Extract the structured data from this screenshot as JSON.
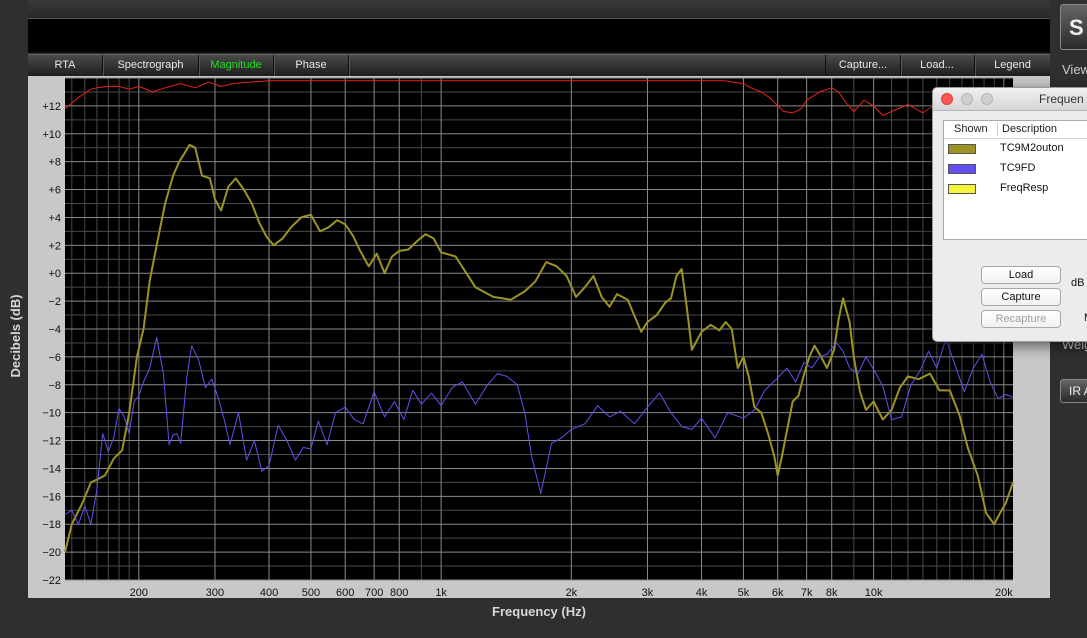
{
  "tabs": {
    "left": [
      {
        "label": "RTA",
        "active": false
      },
      {
        "label": "Spectrograph",
        "active": false
      },
      {
        "label": "Magnitude",
        "active": true
      },
      {
        "label": "Phase",
        "active": false
      }
    ],
    "right": [
      {
        "label": "Capture..."
      },
      {
        "label": "Load..."
      },
      {
        "label": "Legend"
      }
    ]
  },
  "side_panel": {
    "button_initial": "S",
    "view_label": "View",
    "weight_label": "Weig",
    "ir_button": "IR A"
  },
  "legend_window": {
    "title": "Frequen",
    "col_shown": "Shown",
    "col_description": "Description",
    "rows": [
      {
        "name": "TC9M2outon",
        "color": "#9b9422"
      },
      {
        "name": "TC9FD",
        "color": "#6250ee"
      },
      {
        "name": "FreqResp",
        "color": "#f4f43a"
      }
    ],
    "buttons": {
      "load": "Load",
      "capture": "Capture",
      "recapture": "Recapture"
    },
    "side_text": {
      "db": "dB",
      "m": "M"
    }
  },
  "chart_data": {
    "type": "line",
    "title": "",
    "xlabel": "Frequency (Hz)",
    "ylabel": "Decibels (dB)",
    "xscale": "log",
    "xlim": [
      135,
      21000
    ],
    "ylim": [
      -22,
      14
    ],
    "grid": true,
    "x_ticks": [
      200,
      300,
      400,
      500,
      600,
      700,
      800,
      1000,
      2000,
      3000,
      4000,
      5000,
      6000,
      7000,
      8000,
      10000,
      20000
    ],
    "x_tick_labels": [
      "200",
      "300",
      "400",
      "500",
      "600",
      "700",
      "800",
      "1k",
      "2k",
      "3k",
      "4k",
      "5k",
      "6k",
      "7k",
      "8k",
      "10k",
      "20k"
    ],
    "y_ticks": [
      -22,
      -20,
      -18,
      -16,
      -14,
      -12,
      -10,
      -8,
      -6,
      -4,
      -2,
      0,
      2,
      4,
      6,
      8,
      10,
      12
    ],
    "y_tick_labels": [
      "−22",
      "−20",
      "−18",
      "−16",
      "−14",
      "−12",
      "−10",
      "−8",
      "−6",
      "−4",
      "−2",
      "+0",
      "+2",
      "+4",
      "+6",
      "+8",
      "+10",
      "+12"
    ],
    "series": [
      {
        "name": "TC9M2outon",
        "color": "#9b9422",
        "x": [
          135,
          140,
          148,
          155,
          160,
          167,
          175,
          183,
          190,
          198,
          205,
          212,
          220,
          230,
          240,
          248,
          255,
          262,
          270,
          280,
          292,
          300,
          310,
          322,
          335,
          350,
          365,
          380,
          395,
          410,
          430,
          450,
          475,
          500,
          525,
          550,
          575,
          600,
          625,
          650,
          680,
          710,
          740,
          770,
          800,
          840,
          880,
          920,
          960,
          1000,
          1080,
          1200,
          1320,
          1450,
          1560,
          1650,
          1750,
          1850,
          1950,
          2050,
          2150,
          2250,
          2350,
          2450,
          2550,
          2700,
          2900,
          3000,
          3150,
          3300,
          3400,
          3500,
          3600,
          3700,
          3800,
          4000,
          4200,
          4400,
          4550,
          4700,
          4850,
          5000,
          5150,
          5300,
          5500,
          5700,
          5900,
          6000,
          6150,
          6300,
          6500,
          6700,
          6900,
          7100,
          7300,
          7500,
          7800,
          8100,
          8300,
          8500,
          8800,
          9000,
          9300,
          9600,
          10000,
          10500,
          11000,
          11500,
          12000,
          12700,
          13500,
          14200,
          15000,
          15800,
          16500,
          17400,
          18200,
          19000,
          19600,
          20200,
          21000
        ],
        "y": [
          -20,
          -18,
          -16.5,
          -15,
          -14.8,
          -14.5,
          -13.3,
          -12.7,
          -10,
          -6,
          -4,
          -0.5,
          2,
          5,
          7,
          8,
          8.6,
          9.2,
          9,
          7,
          6.8,
          5.3,
          4.5,
          6.2,
          6.8,
          6,
          5,
          3.6,
          2.6,
          2,
          2.5,
          3.3,
          4,
          4.2,
          3,
          3.3,
          3.8,
          3.5,
          2.7,
          1.6,
          0.5,
          1.4,
          0,
          1.2,
          1.6,
          1.7,
          2.3,
          2.8,
          2.5,
          1.5,
          1.2,
          -1,
          -1.7,
          -1.9,
          -1.3,
          -0.6,
          0.8,
          0.5,
          -0.2,
          -1.7,
          -1,
          -0.2,
          -1.7,
          -2.4,
          -1.5,
          -1.9,
          -4.2,
          -3.5,
          -3,
          -2.1,
          -1.8,
          -0.2,
          0.3,
          -2.5,
          -5.5,
          -4.2,
          -3.7,
          -4.1,
          -3.5,
          -4,
          -6.8,
          -6,
          -7.5,
          -9.6,
          -10,
          -11.5,
          -13.2,
          -14.5,
          -13,
          -11.3,
          -9.2,
          -8.8,
          -7.3,
          -6,
          -5.2,
          -5.8,
          -6.8,
          -5.5,
          -3.3,
          -1.8,
          -3.5,
          -6,
          -8.5,
          -9.8,
          -9.2,
          -10.5,
          -9.8,
          -8.2,
          -7.4,
          -7.6,
          -7.2,
          -8.4,
          -8.4,
          -10.2,
          -12.5,
          -14.5,
          -17.2,
          -18,
          -17.2,
          -16.5,
          -15
        ]
      },
      {
        "name": "TC9FD",
        "color": "#6250ee",
        "x": [
          135,
          140,
          145,
          150,
          155,
          160,
          165,
          170,
          175,
          180,
          185,
          190,
          195,
          200,
          205,
          212,
          220,
          228,
          235,
          240,
          245,
          250,
          258,
          265,
          275,
          285,
          295,
          305,
          315,
          325,
          340,
          355,
          370,
          385,
          400,
          420,
          440,
          460,
          480,
          500,
          520,
          545,
          570,
          600,
          630,
          660,
          700,
          740,
          780,
          820,
          860,
          900,
          950,
          1000,
          1060,
          1120,
          1200,
          1280,
          1350,
          1420,
          1500,
          1560,
          1620,
          1700,
          1800,
          1900,
          2000,
          2150,
          2300,
          2450,
          2600,
          2800,
          3000,
          3200,
          3400,
          3600,
          3800,
          4000,
          4300,
          4600,
          5000,
          5300,
          5600,
          6000,
          6300,
          6600,
          6900,
          7200,
          7500,
          7800,
          8200,
          8500,
          8800,
          9200,
          9600,
          10000,
          10500,
          11000,
          11600,
          12200,
          12800,
          13400,
          14000,
          14700,
          15400,
          16200,
          17000,
          17800,
          18600,
          19400,
          20200,
          21000
        ],
        "y": [
          -17.3,
          -17,
          -18,
          -16.7,
          -18,
          -15.5,
          -11.5,
          -12.8,
          -11.8,
          -9.7,
          -10.3,
          -11.5,
          -9.2,
          -8.8,
          -7.8,
          -6.8,
          -4.6,
          -7.2,
          -12.3,
          -11.6,
          -11.5,
          -12.2,
          -7.5,
          -5.2,
          -6.2,
          -8.2,
          -7.6,
          -8.9,
          -10.5,
          -12.3,
          -10,
          -13.4,
          -12,
          -14.2,
          -13.8,
          -10.9,
          -12,
          -13.4,
          -12.5,
          -12.6,
          -10.6,
          -12.3,
          -10,
          -9.6,
          -10.5,
          -10.8,
          -8.5,
          -10.3,
          -9.2,
          -10.5,
          -8.4,
          -9.4,
          -8.6,
          -9.5,
          -8.2,
          -7.8,
          -9.4,
          -8,
          -7.2,
          -7.4,
          -8,
          -10,
          -13.2,
          -15.8,
          -12.2,
          -11.8,
          -11.2,
          -10.8,
          -9.5,
          -10.3,
          -9.9,
          -10.8,
          -9.6,
          -8.6,
          -10,
          -11,
          -11.2,
          -10.4,
          -11.8,
          -10,
          -10.4,
          -9.8,
          -8.4,
          -7.5,
          -6.8,
          -7.8,
          -6.4,
          -6.8,
          -6,
          -5.8,
          -5,
          -5.6,
          -6.8,
          -7.2,
          -6,
          -6.9,
          -8.1,
          -10.5,
          -10.3,
          -8,
          -7,
          -5.6,
          -6.8,
          -4.7,
          -6.5,
          -8.5,
          -6.8,
          -5.8,
          -7.8,
          -9,
          -8.7,
          -8.9
        ]
      },
      {
        "name": "FreqResp",
        "color": "#e8231a",
        "x": [
          135,
          140,
          145,
          150,
          155,
          160,
          170,
          180,
          190,
          200,
          215,
          230,
          250,
          270,
          290,
          310,
          330,
          360,
          400,
          450,
          500,
          600,
          700,
          800,
          1000,
          1200,
          1500,
          2000,
          2500,
          3000,
          3500,
          4000,
          4500,
          5000,
          5200,
          5500,
          5800,
          6000,
          6200,
          6500,
          6800,
          7000,
          7500,
          8000,
          8300,
          8600,
          9000,
          9500,
          10000,
          10500,
          11000,
          12000,
          13000,
          14000,
          15000,
          16000,
          17000,
          18000,
          19000,
          20000,
          21000
        ],
        "y": [
          11.8,
          12.2,
          12.6,
          12.9,
          13.2,
          13.3,
          13.4,
          13.4,
          13.2,
          13.4,
          13,
          13.3,
          13.6,
          13.3,
          13.7,
          13.4,
          13.6,
          13.7,
          13.8,
          13.8,
          13.8,
          13.8,
          13.8,
          13.8,
          13.8,
          13.8,
          13.8,
          13.8,
          13.8,
          13.8,
          13.8,
          13.8,
          13.8,
          13.6,
          13.3,
          13,
          12.5,
          12,
          11.6,
          11.5,
          11.8,
          12.4,
          13,
          13.3,
          13,
          12.3,
          11.6,
          12.4,
          12,
          11.3,
          11.6,
          12.1,
          11.5,
          12.2,
          11.7,
          12.5,
          11.4,
          12.3,
          11,
          12.2,
          11.2
        ]
      }
    ]
  }
}
